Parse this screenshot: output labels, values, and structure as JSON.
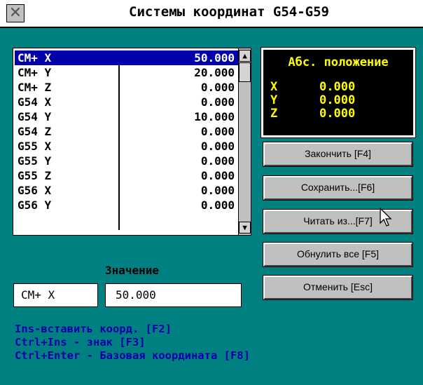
{
  "window": {
    "title": "Системы координат G54-G59"
  },
  "list": {
    "rows": [
      {
        "coord": "CM+ X",
        "value": "50.000"
      },
      {
        "coord": "CM+ Y",
        "value": "20.000"
      },
      {
        "coord": "CM+ Z",
        "value": "0.000"
      },
      {
        "coord": "G54 X",
        "value": "0.000"
      },
      {
        "coord": "G54 Y",
        "value": "10.000"
      },
      {
        "coord": "G54 Z",
        "value": "0.000"
      },
      {
        "coord": "G55 X",
        "value": "0.000"
      },
      {
        "coord": "G55 Y",
        "value": "0.000"
      },
      {
        "coord": "G55 Z",
        "value": "0.000"
      },
      {
        "coord": "G56 X",
        "value": "0.000"
      },
      {
        "coord": "G56 Y",
        "value": "0.000"
      }
    ],
    "selected_index": 0
  },
  "abs_position": {
    "title": "Абс. положение",
    "rows": [
      {
        "axis": "X",
        "value": "0.000"
      },
      {
        "axis": "Y",
        "value": "0.000"
      },
      {
        "axis": "Z",
        "value": "0.000"
      }
    ]
  },
  "buttons": {
    "finish": "Закончить [F4]",
    "save": "Сохранить...[F6]",
    "read": "Читать из...[F7]",
    "reset_all": "Обнулить все [F5]",
    "cancel": "Отменить [Esc]"
  },
  "value_panel": {
    "label": "Значение",
    "coord": "CM+ X",
    "value": "50.000"
  },
  "hints": [
    "Ins-вставить коорд. [F2]",
    "Ctrl+Ins - знак [F3]",
    "Ctrl+Enter - Базовая координата [F8]"
  ],
  "icons": {
    "close": "close-icon",
    "scroll_up": "arrow-up-icon",
    "scroll_down": "arrow-down-icon",
    "cursor": "mouse-pointer-icon"
  }
}
